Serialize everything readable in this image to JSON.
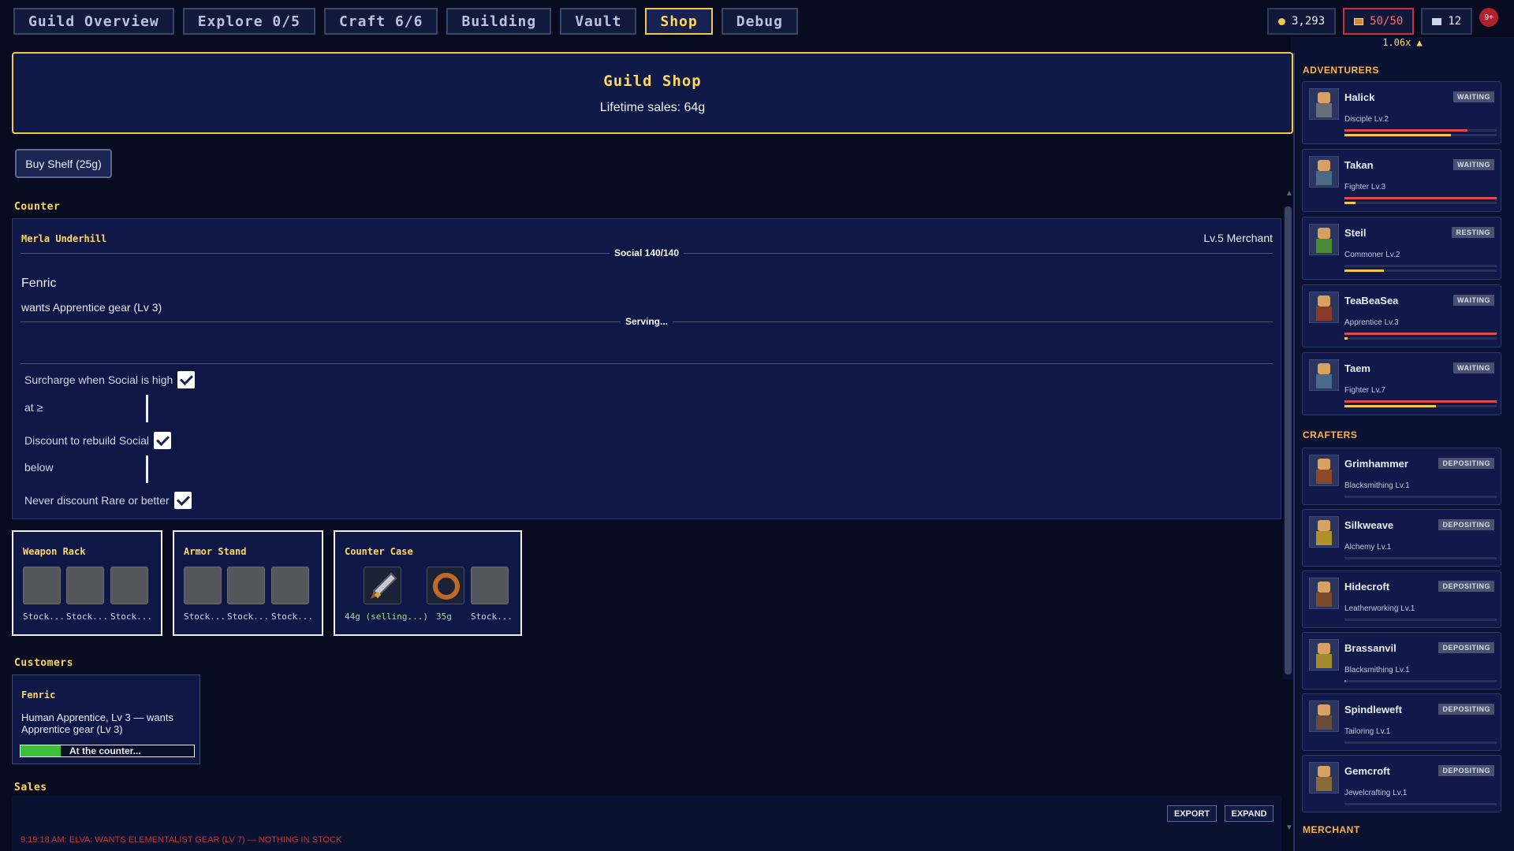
{
  "nav": {
    "tabs": [
      {
        "label": "Guild Overview"
      },
      {
        "label": "Explore 0/5"
      },
      {
        "label": "Craft 6/6"
      },
      {
        "label": "Building"
      },
      {
        "label": "Vault"
      },
      {
        "label": "Shop"
      },
      {
        "label": "Debug"
      }
    ],
    "active_tab": "Shop"
  },
  "stats": {
    "gold": "3,293",
    "storage": "50/50",
    "members": "12",
    "notifications": "9+"
  },
  "speed_label": "1.06x ▲",
  "shop": {
    "title": "Guild Shop",
    "lifetime_sales": "Lifetime sales: 64g",
    "buy_shelf_label": "Buy Shelf (25g)"
  },
  "counter": {
    "section_label": "Counter",
    "merchant_name": "Merla Underhill",
    "merchant_level": "Lv.5 Merchant",
    "social_label": "Social 140/140",
    "customer_name": "Fenric",
    "customer_want": "wants Apprentice gear (Lv 3)",
    "serving_label": "Serving...",
    "options": {
      "surcharge_label": "Surcharge when Social is high",
      "surcharge_checked": true,
      "at_label": "at ≥",
      "discount_label": "Discount to rebuild Social",
      "discount_checked": true,
      "below_label": "below",
      "never_discount_label": "Never discount Rare or better",
      "never_discount_checked": true
    }
  },
  "shelves": [
    {
      "title": "Weapon Rack",
      "slots": [
        {
          "label": "Stock..."
        },
        {
          "label": "Stock..."
        },
        {
          "label": "Stock..."
        }
      ]
    },
    {
      "title": "Armor Stand",
      "slots": [
        {
          "label": "Stock..."
        },
        {
          "label": "Stock..."
        },
        {
          "label": "Stock..."
        }
      ]
    },
    {
      "title": "Counter Case",
      "slots": [
        {
          "label": "44g (selling...)",
          "item": "sword-icon"
        },
        {
          "label": "35g",
          "item": "amulet-icon"
        },
        {
          "label": "Stock..."
        }
      ]
    }
  ],
  "customers": {
    "section_label": "Customers",
    "list": [
      {
        "name": "Fenric",
        "desc": "Human Apprentice, Lv 3 — wants Apprentice gear (Lv 3)",
        "status": "At the counter...",
        "progress": 0.23
      }
    ]
  },
  "sales": {
    "section_label": "Sales",
    "export_label": "EXPORT",
    "expand_label": "EXPAND",
    "log_line": "9:19:18 AM: ELVA: WANTS ELEMENTALIST GEAR (LV 7) — NOTHING IN STOCK"
  },
  "sidebar": {
    "adventurers_label": "ADVENTURERS",
    "adventurers": [
      {
        "name": "Halick",
        "cls": "Disciple Lv.2",
        "status": "WAITING",
        "hp": 0.81,
        "xp": 0.7
      },
      {
        "name": "Takan",
        "cls": "Fighter Lv.3",
        "status": "WAITING",
        "hp": 1.0,
        "xp": 0.07
      },
      {
        "name": "Steil",
        "cls": "Commoner Lv.2",
        "status": "RESTING",
        "hp": 0.0,
        "xp": 0.26
      },
      {
        "name": "TeaBeaSea",
        "cls": "Apprentice Lv.3",
        "status": "WAITING",
        "hp": 1.0,
        "xp": 0.02
      },
      {
        "name": "Taem",
        "cls": "Fighter Lv.7",
        "status": "WAITING",
        "hp": 1.0,
        "xp": 0.6
      }
    ],
    "crafters_label": "CRAFTERS",
    "crafters": [
      {
        "name": "Grimhammer",
        "cls": "Blacksmithing Lv.1",
        "status": "DEPOSITING",
        "xp": 0.0
      },
      {
        "name": "Silkweave",
        "cls": "Alchemy Lv.1",
        "status": "DEPOSITING",
        "xp": 0.0
      },
      {
        "name": "Hidecroft",
        "cls": "Leatherworking Lv.1",
        "status": "DEPOSITING",
        "xp": 0.0
      },
      {
        "name": "Brassanvil",
        "cls": "Blacksmithing Lv.1",
        "status": "DEPOSITING",
        "xp": 0.01
      },
      {
        "name": "Spindleweft",
        "cls": "Tailoring Lv.1",
        "status": "DEPOSITING",
        "xp": 0.0
      },
      {
        "name": "Gemcroft",
        "cls": "Jewelcrafting Lv.1",
        "status": "DEPOSITING",
        "xp": 0.0
      }
    ],
    "merchant_label": "MERCHANT"
  },
  "colors": {
    "accent": "#f2c84b",
    "hp": "#e04a4a",
    "xp": "#f2c84b",
    "progress": "#3fbf3a"
  }
}
